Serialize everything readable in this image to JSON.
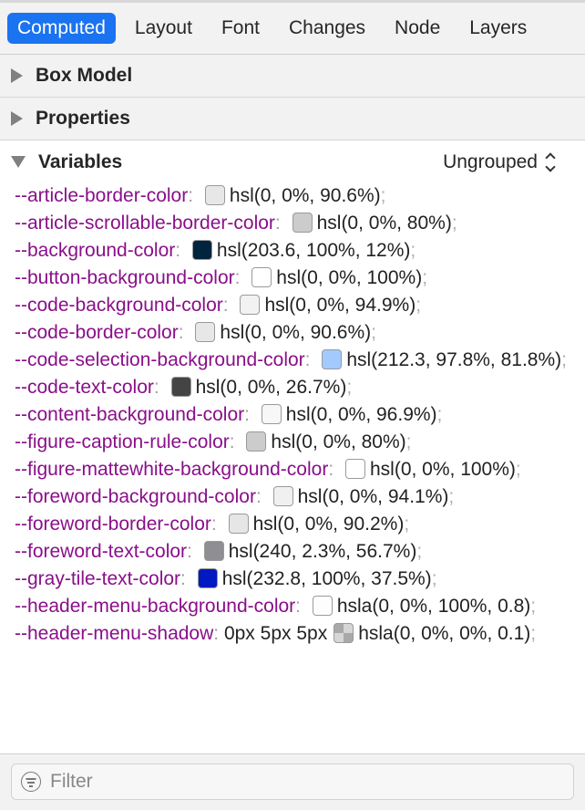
{
  "tabs": [
    {
      "label": "Computed",
      "active": true
    },
    {
      "label": "Layout",
      "active": false
    },
    {
      "label": "Font",
      "active": false
    },
    {
      "label": "Changes",
      "active": false
    },
    {
      "label": "Node",
      "active": false
    },
    {
      "label": "Layers",
      "active": false
    }
  ],
  "sections": {
    "box_model": {
      "label": "Box Model",
      "expanded": false
    },
    "properties": {
      "label": "Properties",
      "expanded": false
    },
    "variables": {
      "label": "Variables",
      "expanded": true,
      "grouping": "Ungrouped"
    }
  },
  "variables": [
    {
      "name": "--article-border-color",
      "prefix": "",
      "value": "hsl(0, 0%, 90.6%)",
      "swatch": "#e7e7e7"
    },
    {
      "name": "--article-scrollable-border-color",
      "prefix": "",
      "value": "hsl(0, 0%, 80%)",
      "swatch": "#cccccc"
    },
    {
      "name": "--background-color",
      "prefix": "",
      "value": "hsl(203.6, 100%, 12%)",
      "swatch": "#00243d"
    },
    {
      "name": "--button-background-color",
      "prefix": "",
      "value": "hsl(0, 0%, 100%)",
      "swatch": "#ffffff"
    },
    {
      "name": "--code-background-color",
      "prefix": "",
      "value": "hsl(0, 0%, 94.9%)",
      "swatch": "#f2f2f2"
    },
    {
      "name": "--code-border-color",
      "prefix": "",
      "value": "hsl(0, 0%, 90.6%)",
      "swatch": "#e7e7e7"
    },
    {
      "name": "--code-selection-background-color",
      "prefix": "",
      "value": "hsl(212.3, 97.8%, 81.8%)",
      "swatch": "#a3cafe"
    },
    {
      "name": "--code-text-color",
      "prefix": "",
      "value": "hsl(0, 0%, 26.7%)",
      "swatch": "#444444"
    },
    {
      "name": "--content-background-color",
      "prefix": "",
      "value": "hsl(0, 0%, 96.9%)",
      "swatch": "#f7f7f7"
    },
    {
      "name": "--figure-caption-rule-color",
      "prefix": "",
      "value": "hsl(0, 0%, 80%)",
      "swatch": "#cccccc"
    },
    {
      "name": "--figure-mattewhite-background-color",
      "prefix": "",
      "value": "hsl(0, 0%, 100%)",
      "swatch": "#ffffff"
    },
    {
      "name": "--foreword-background-color",
      "prefix": "",
      "value": "hsl(0, 0%, 94.1%)",
      "swatch": "#f0f0f0"
    },
    {
      "name": "--foreword-border-color",
      "prefix": "",
      "value": "hsl(0, 0%, 90.2%)",
      "swatch": "#e6e6e6"
    },
    {
      "name": "--foreword-text-color",
      "prefix": "",
      "value": "hsl(240, 2.3%, 56.7%)",
      "swatch": "#8e8e93"
    },
    {
      "name": "--gray-tile-text-color",
      "prefix": "",
      "value": "hsl(232.8, 100%, 37.5%)",
      "swatch": "#0019c0"
    },
    {
      "name": "--header-menu-background-color",
      "prefix": "",
      "value": "hsla(0, 0%, 100%, 0.8)",
      "swatch": "#fdfdfd"
    },
    {
      "name": "--header-menu-shadow",
      "prefix": "0px 5px 5px",
      "value": "hsla(0, 0%, 0%, 0.1)",
      "swatch": "checker"
    }
  ],
  "filter": {
    "placeholder": "Filter",
    "value": ""
  }
}
